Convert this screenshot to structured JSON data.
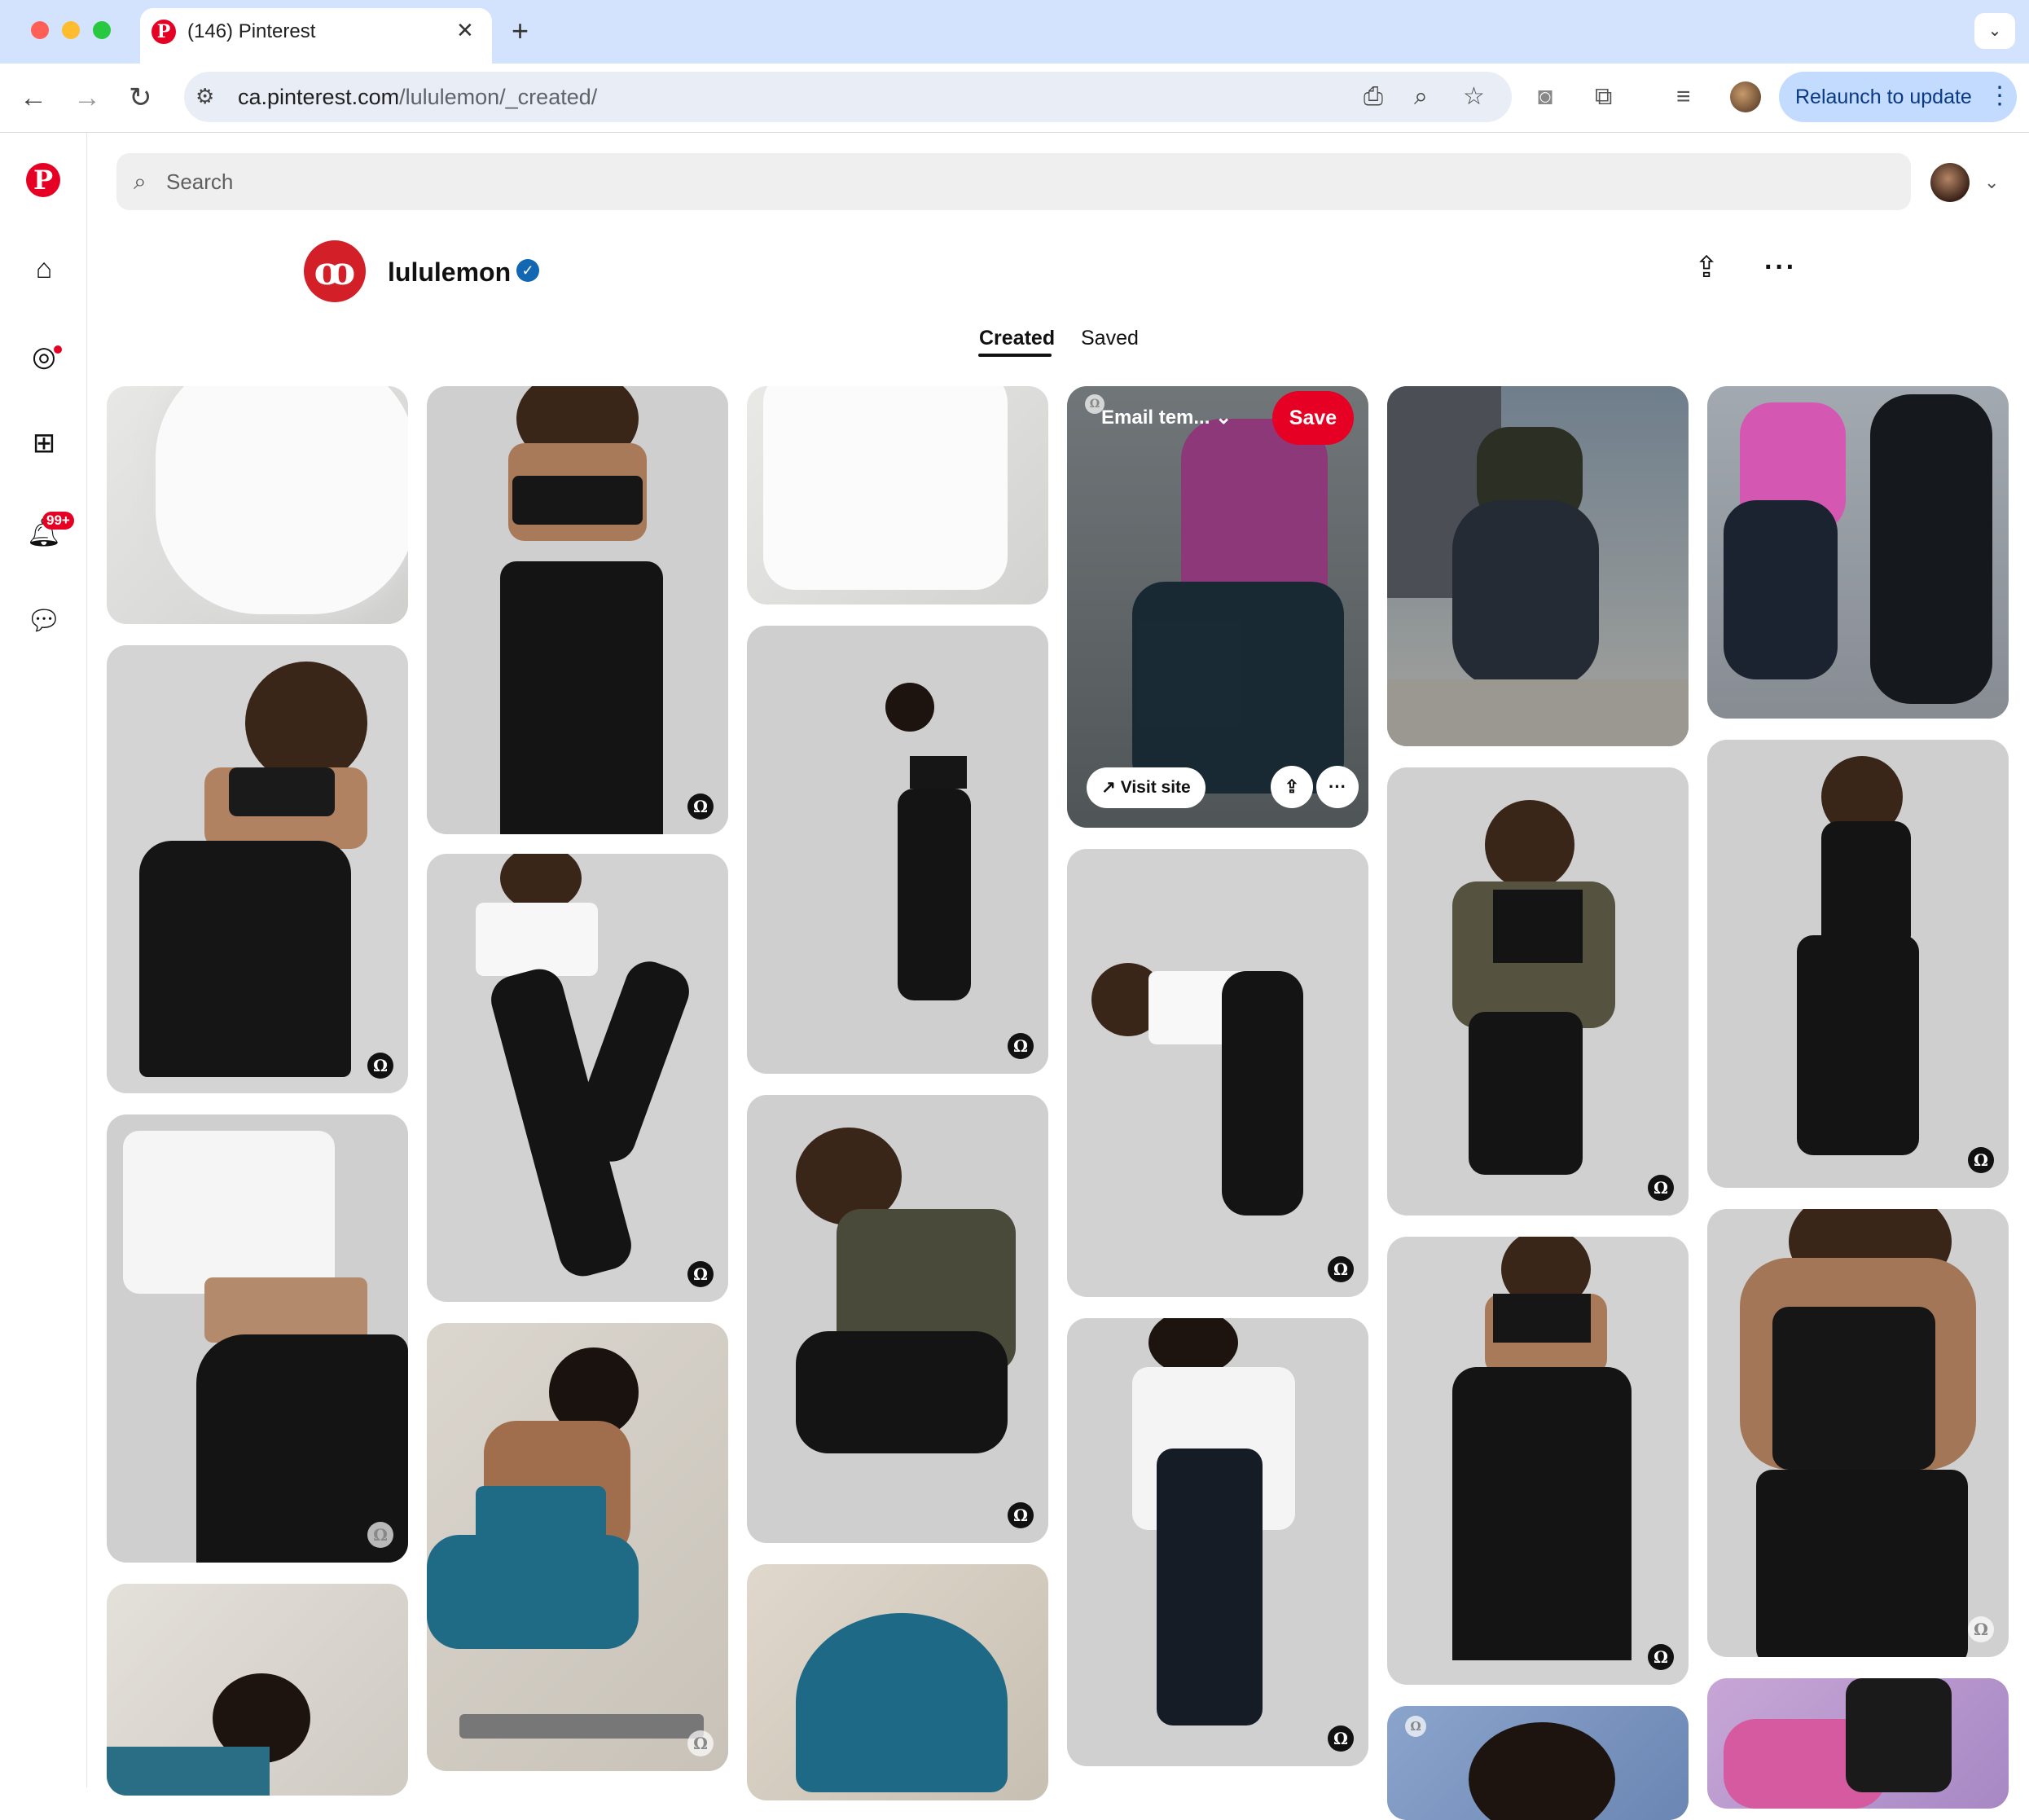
{
  "browser": {
    "tab_title": "(146) Pinterest",
    "url_host": "ca.pinterest.com",
    "url_path": "/lululemon/_created/",
    "relaunch_label": "Relaunch to update",
    "icons": [
      "back-icon",
      "forward-icon",
      "reload-icon",
      "site-settings-icon",
      "install-app-icon",
      "zoom-icon",
      "bookmark-star-icon",
      "camera-icon",
      "extensions-icon",
      "media-control-icon",
      "profile-avatar",
      "more-vert-icon"
    ]
  },
  "search": {
    "placeholder": "Search"
  },
  "sidebar": {
    "items": [
      "pinterest-logo",
      "home-icon",
      "explore-icon",
      "create-icon",
      "notifications-icon",
      "messages-icon"
    ],
    "notifications_badge": "99+"
  },
  "profile": {
    "name": "lululemon",
    "logo_glyph": "ꝏ",
    "tabs": [
      {
        "label": "Created",
        "active": true
      },
      {
        "label": "Saved",
        "active": false
      }
    ]
  },
  "hover_pin": {
    "board_label": "Email tem...",
    "save_label": "Save",
    "visit_label": "Visit site"
  },
  "colors": {
    "brand_red": "#e60023",
    "lulu_red": "#d31f27",
    "chrome_blue": "#d3e3fd"
  }
}
